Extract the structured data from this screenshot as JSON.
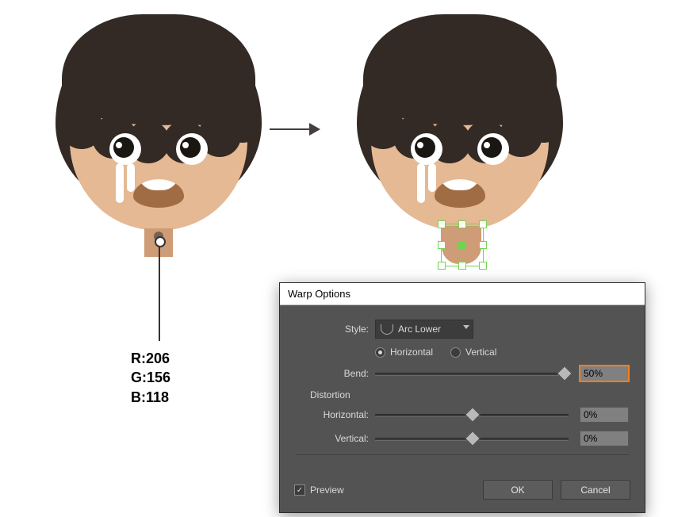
{
  "annotation": {
    "r": "R:206",
    "g": "G:156",
    "b": "B:118"
  },
  "dialog": {
    "title": "Warp Options",
    "style_label": "Style:",
    "style_value": "Arc Lower",
    "orientation": {
      "horizontal": "Horizontal",
      "vertical": "Vertical",
      "selected": "horizontal"
    },
    "bend": {
      "label": "Bend:",
      "value": "50%",
      "pos": 1.0
    },
    "distortion_label": "Distortion",
    "dist_h": {
      "label": "Horizontal:",
      "value": "0%",
      "pos": 0.5
    },
    "dist_v": {
      "label": "Vertical:",
      "value": "0%",
      "pos": 0.5
    },
    "preview": {
      "label": "Preview",
      "checked": true
    },
    "ok": "OK",
    "cancel": "Cancel"
  }
}
